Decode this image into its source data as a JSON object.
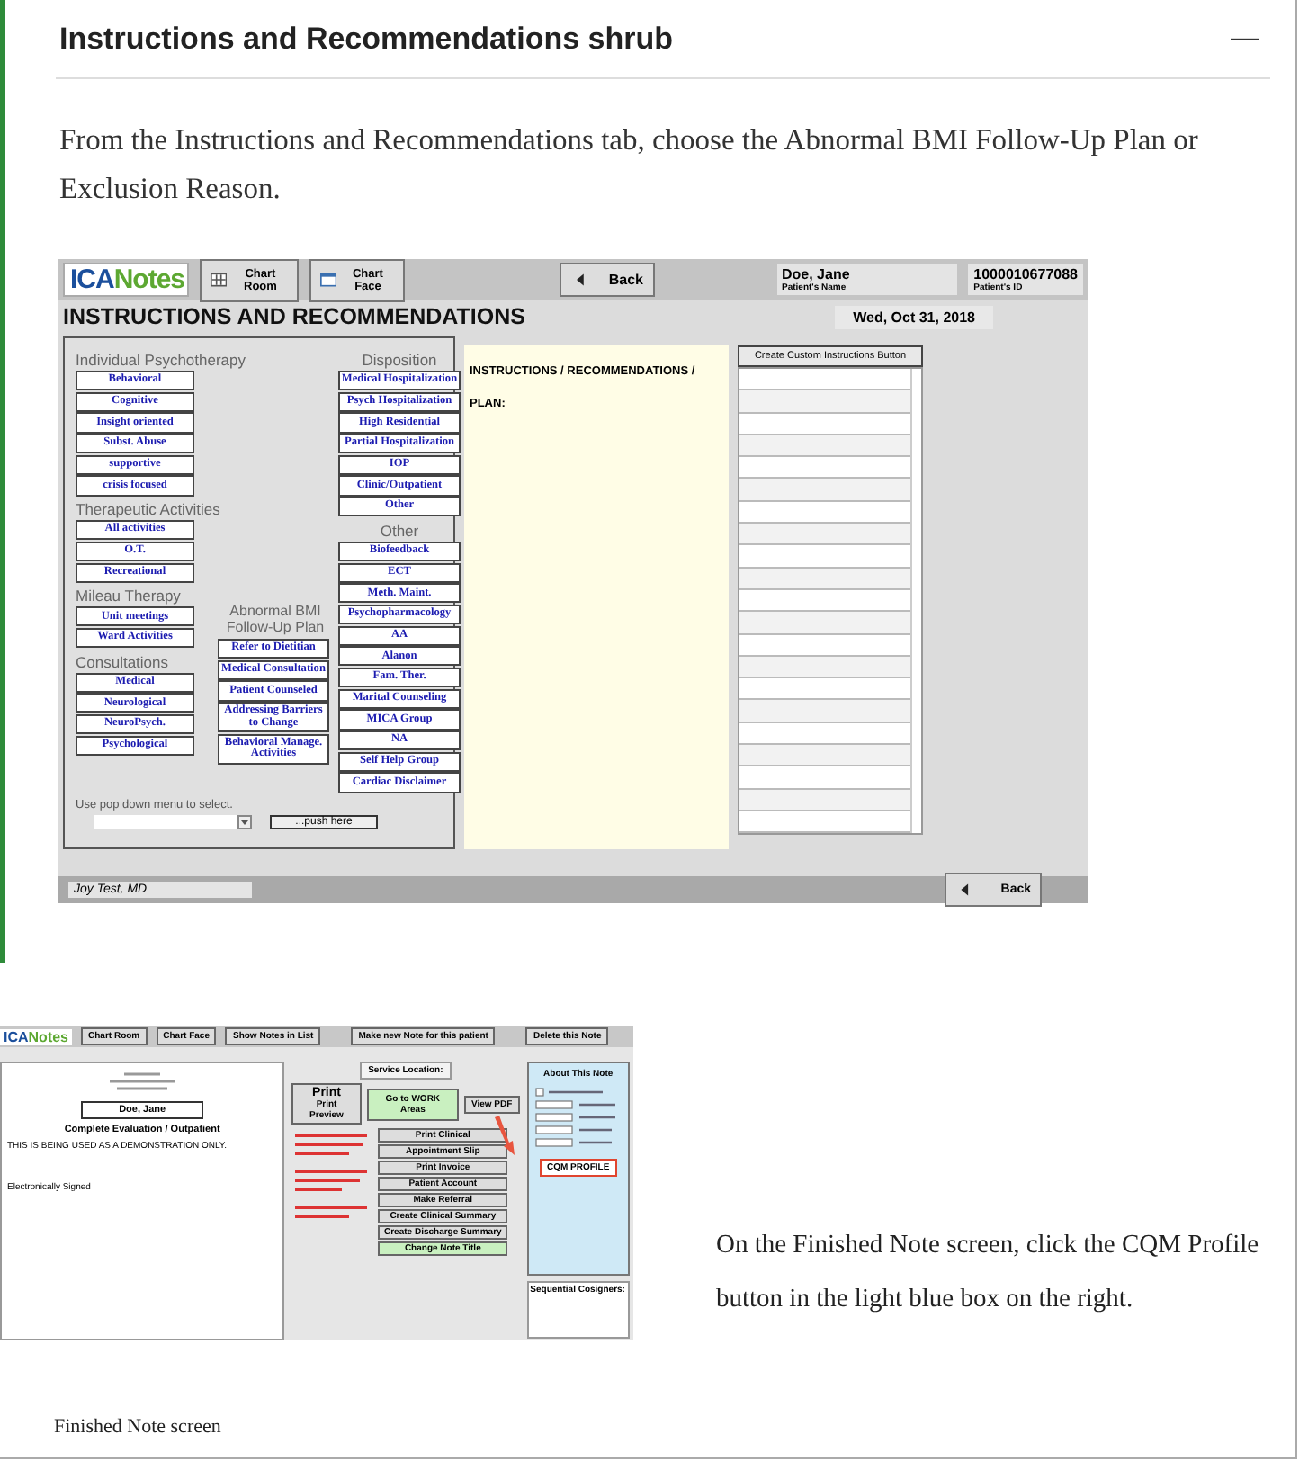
{
  "section": {
    "title": "Instructions and Recommendations shrub",
    "toggle": "—"
  },
  "intro": "From the Instructions and Recommendations tab, choose the Abnormal BMI Follow-Up Plan or Exclusion Reason.",
  "screenshot_1": {
    "logo": [
      "ICA",
      "Notes"
    ],
    "toolbar_buttons": [
      "Chart Room",
      "Chart Face"
    ],
    "back_button": "Back",
    "patient_name": "Doe, Jane",
    "patient_name_label": "Patient's Name",
    "patient_id": "1000010677088",
    "patient_id_label": "Patient's ID",
    "title": "INSTRUCTIONS AND RECOMMENDATIONS",
    "date": "Wed, Oct 31, 2018",
    "left_column": [
      {
        "title": "Individual  Psychotherapy",
        "buttons": [
          "Behavioral",
          "Cognitive",
          "Insight oriented",
          "Subst. Abuse",
          "supportive",
          "crisis focused"
        ]
      },
      {
        "title": "Therapeutic Activities",
        "buttons": [
          "All activities",
          "O.T.",
          "Recreational"
        ]
      },
      {
        "title": "Mileau Therapy",
        "buttons": [
          "Unit meetings",
          "Ward Activities"
        ]
      },
      {
        "title": "Consultations",
        "buttons": [
          "Medical",
          "Neurological",
          "NeuroPsych.",
          "Psychological"
        ]
      }
    ],
    "middle_column": [
      {
        "title": "Abnormal BMI Follow-Up Plan",
        "buttons": [
          "Refer to Dietitian",
          "Medical Consultation",
          "Patient Counseled",
          "Addressing Barriers to Change",
          "Behavioral Manage. Activities"
        ]
      }
    ],
    "right_column": [
      {
        "title": "Disposition",
        "buttons": [
          "Medical Hospitalization",
          "Psych Hospitalization",
          "High Residential",
          "Partial Hospitalization",
          "IOP",
          "Clinic/Outpatient",
          "Other"
        ]
      },
      {
        "title": "Other",
        "buttons": [
          "Biofeedback",
          "ECT",
          "Meth. Maint.",
          "Psychopharmacology",
          "AA",
          "Alanon",
          "Fam. Ther.",
          "Marital Counseling",
          "MICA Group",
          "NA",
          "Self Help Group",
          "Cardiac Disclaimer"
        ]
      }
    ],
    "popdown_label": "Use pop down menu to select.",
    "push_button": "...push here",
    "plan_label": "INSTRUCTIONS / RECOMMENDATIONS / PLAN:",
    "custom_button": "Create Custom Instructions Button",
    "user": "Joy Test, MD",
    "footer_back": "Back"
  },
  "screenshot_2": {
    "logo": [
      "ICA",
      "Notes"
    ],
    "toolbar_buttons": [
      "Chart Room",
      "Chart Face"
    ],
    "show_notes": "Show Notes in List",
    "make_new": "Make new Note for this patient",
    "delete": "Delete this Note",
    "patient": "Doe, Jane",
    "note_type": "Complete Evaluation / Outpatient",
    "demo_text": "THIS IS BEING USED AS A DEMONSTRATION ONLY.",
    "signed": "Electronically Signed",
    "service_location_label": "Service Location:",
    "print": "Print",
    "print_preview": "Print Preview",
    "work_areas": "Go to WORK Areas",
    "view_pdf": "View PDF",
    "actions": [
      "Print Clinical",
      "Appointment Slip",
      "Print Invoice",
      "Patient Account",
      "Make Referral",
      "Create Clinical Summary",
      "Create Discharge Summary"
    ],
    "change_title": "Change Note Title",
    "about": "About This Note",
    "cqm": "CQM PROFILE",
    "cosigners": "Sequential Cosigners:"
  },
  "caption": "Finished Note screen",
  "instruction": "On the Finished Note screen, click the CQM Profile button in the light blue box on the right."
}
